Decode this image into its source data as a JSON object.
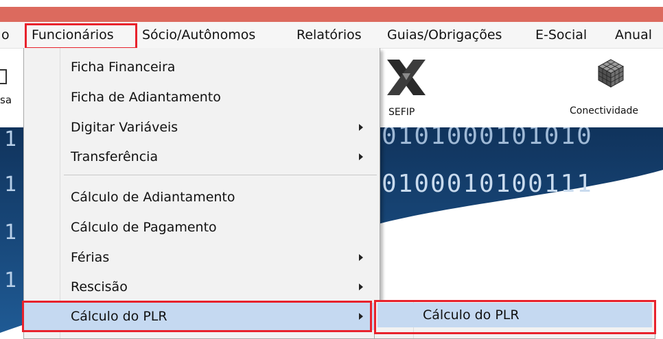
{
  "colors": {
    "titlebar": "#dc6a5e",
    "highlight_box": "#e8222c",
    "menu_hover": "#c5d9f1",
    "banner_blue": "#17375e"
  },
  "menubar": {
    "items": [
      {
        "label": "o"
      },
      {
        "label": "Funcionários"
      },
      {
        "label": "Sócio/Autônomos"
      },
      {
        "label": "Relatórios"
      },
      {
        "label": "Guias/Obrigações"
      },
      {
        "label": "E-Social"
      },
      {
        "label": "Anual"
      }
    ]
  },
  "toolbar": {
    "left_partial": "sa",
    "sefip_label": "SEFIP",
    "sefip_icon": "sefip-x-icon",
    "conectividade_label": "Conectividade",
    "conectividade_icon": "cube-icon"
  },
  "banner": {
    "binary_row_1": "0101000101010",
    "binary_row_2": "0100010100111",
    "left_digits": [
      "1",
      "1",
      "1",
      "1"
    ]
  },
  "funcionarios_menu": {
    "items": [
      {
        "label": "Ficha Financeira",
        "submenu": false
      },
      {
        "label": "Ficha de Adiantamento",
        "submenu": false
      },
      {
        "label": "Digitar Variáveis",
        "submenu": true
      },
      {
        "label": "Transferência",
        "submenu": true
      },
      {
        "label": "Cálculo de Adiantamento",
        "submenu": false
      },
      {
        "label": "Cálculo de Pagamento",
        "submenu": false
      },
      {
        "label": "Férias",
        "submenu": true
      },
      {
        "label": "Rescisão",
        "submenu": true
      },
      {
        "label": "Cálculo do PLR",
        "submenu": true,
        "active": true
      }
    ]
  },
  "plr_submenu": {
    "items": [
      {
        "label": "Cálculo do PLR"
      }
    ]
  }
}
